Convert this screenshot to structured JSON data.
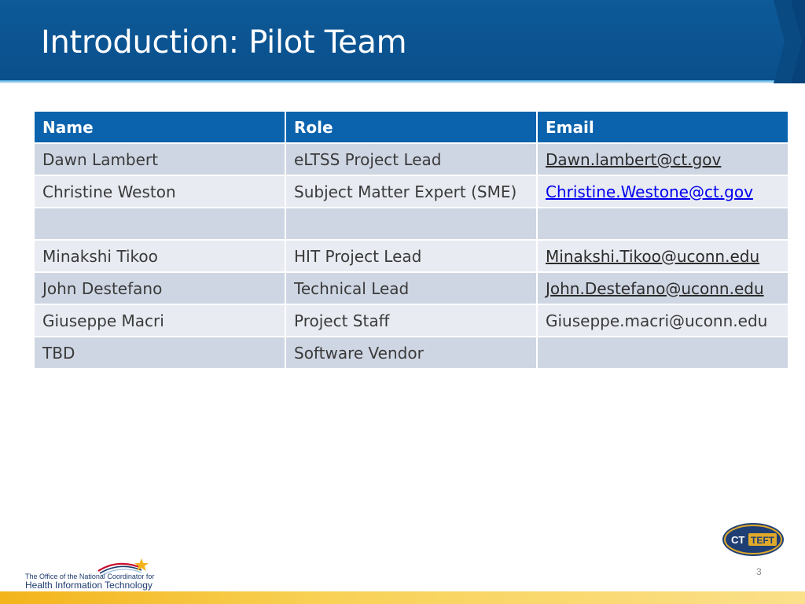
{
  "slide": {
    "title": "Introduction: Pilot Team",
    "page_number": "3"
  },
  "table": {
    "headers": [
      "Name",
      "Role",
      "Email"
    ],
    "rows": [
      {
        "name": "Dawn Lambert",
        "role": "eLTSS Project Lead",
        "email": "Dawn.lambert@ct.gov"
      },
      {
        "name": "Christine Weston",
        "role": "Subject Matter Expert (SME)",
        "email": "Christine.Westone@ct.gov"
      },
      {
        "name": "",
        "role": "",
        "email": ""
      },
      {
        "name": "Minakshi Tikoo",
        "role": "HIT Project Lead",
        "email": "Minakshi.Tikoo@uconn.edu"
      },
      {
        "name": "John Destefano",
        "role": "Technical Lead",
        "email": "John.Destefano@uconn.edu"
      },
      {
        "name": "Giuseppe Macri",
        "role": "Project Staff",
        "email": "Giuseppe.macri@uconn.edu"
      },
      {
        "name": "TBD",
        "role": "Software Vendor",
        "email": ""
      }
    ]
  },
  "footer": {
    "onc_line1": "The Office of the National Coordinator for",
    "onc_line2": "Health Information Technology",
    "ct_logo_left": "CT",
    "ct_logo_right": "TEFT"
  },
  "colors": {
    "header_blue": "#0a4f8c",
    "table_header": "#0b63ad",
    "row_dark": "#cfd6e3",
    "row_light": "#e8ebf2",
    "footer_gold": "#f3b41b"
  }
}
